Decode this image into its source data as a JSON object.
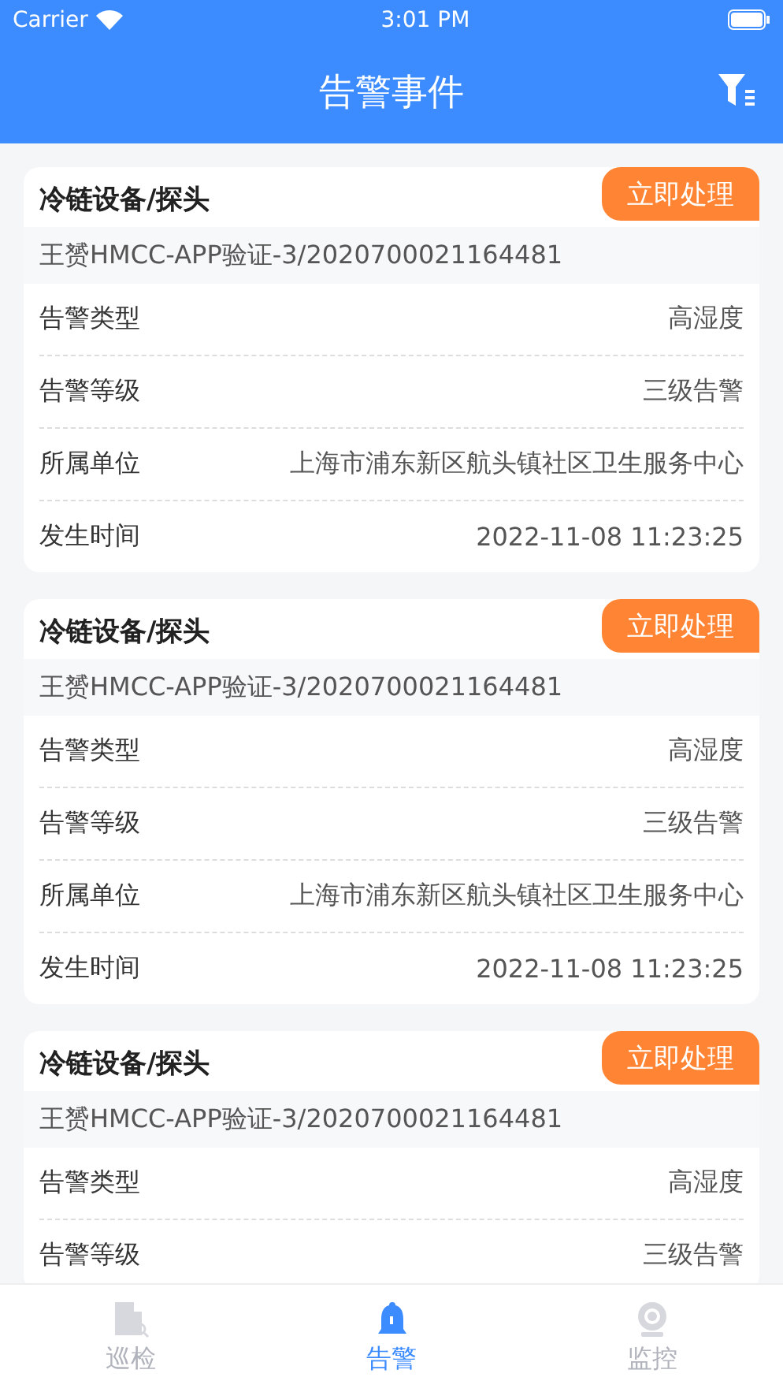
{
  "status_bar": {
    "carrier": "Carrier",
    "time": "3:01 PM"
  },
  "nav": {
    "title": "告警事件"
  },
  "alarms": [
    {
      "title": "冷链设备/探头",
      "action": "立即处理",
      "device": "王赟HMCC-APP验证-3/2020700021164481",
      "fields": [
        {
          "label": "告警类型",
          "value": "高湿度"
        },
        {
          "label": "告警等级",
          "value": "三级告警"
        },
        {
          "label": "所属单位",
          "value": "上海市浦东新区航头镇社区卫生服务中心"
        },
        {
          "label": "发生时间",
          "value": "2022-11-08 11:23:25"
        }
      ]
    },
    {
      "title": "冷链设备/探头",
      "action": "立即处理",
      "device": "王赟HMCC-APP验证-3/2020700021164481",
      "fields": [
        {
          "label": "告警类型",
          "value": "高湿度"
        },
        {
          "label": "告警等级",
          "value": "三级告警"
        },
        {
          "label": "所属单位",
          "value": "上海市浦东新区航头镇社区卫生服务中心"
        },
        {
          "label": "发生时间",
          "value": "2022-11-08 11:23:25"
        }
      ]
    },
    {
      "title": "冷链设备/探头",
      "action": "立即处理",
      "device": "王赟HMCC-APP验证-3/2020700021164481",
      "fields": [
        {
          "label": "告警类型",
          "value": "高湿度"
        },
        {
          "label": "告警等级",
          "value": "三级告警"
        }
      ]
    }
  ],
  "tabs": [
    {
      "label": "巡检",
      "kind": "inspect",
      "selected": false
    },
    {
      "label": "告警",
      "kind": "alarm",
      "selected": true
    },
    {
      "label": "监控",
      "kind": "monitor",
      "selected": false
    }
  ]
}
